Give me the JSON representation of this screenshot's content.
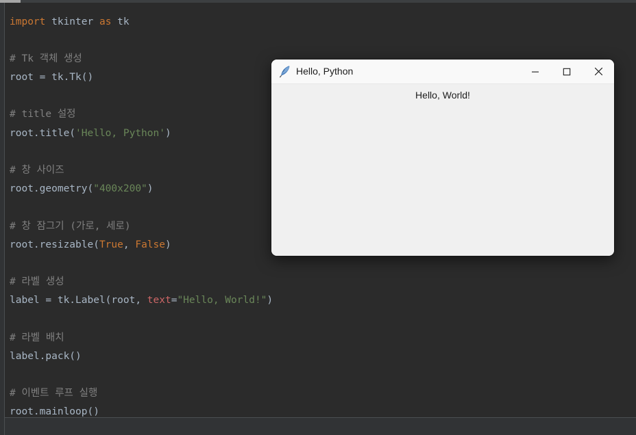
{
  "editor": {
    "scrollbar": {
      "name": "horizontal-scrollbar"
    },
    "lines": [
      {
        "i": 0,
        "tokens": [
          {
            "t": "kw",
            "v": "import"
          },
          {
            "t": "pln",
            "v": " tkinter "
          },
          {
            "t": "kw",
            "v": "as"
          },
          {
            "t": "pln",
            "v": " tk"
          }
        ]
      },
      {
        "i": 1,
        "tokens": []
      },
      {
        "i": 2,
        "tokens": [
          {
            "t": "cmt",
            "v": "# Tk 객체 생성"
          }
        ]
      },
      {
        "i": 3,
        "tokens": [
          {
            "t": "pln",
            "v": "root = tk.Tk()"
          }
        ]
      },
      {
        "i": 4,
        "tokens": []
      },
      {
        "i": 5,
        "tokens": [
          {
            "t": "cmt",
            "v": "# title 설정"
          }
        ]
      },
      {
        "i": 6,
        "tokens": [
          {
            "t": "pln",
            "v": "root.title("
          },
          {
            "t": "str",
            "v": "'Hello, Python'"
          },
          {
            "t": "pln",
            "v": ")"
          }
        ]
      },
      {
        "i": 7,
        "tokens": []
      },
      {
        "i": 8,
        "tokens": [
          {
            "t": "cmt",
            "v": "# 창 사이즈"
          }
        ]
      },
      {
        "i": 9,
        "tokens": [
          {
            "t": "pln",
            "v": "root.geometry("
          },
          {
            "t": "str",
            "v": "\"400x200\""
          },
          {
            "t": "pln",
            "v": ")"
          }
        ]
      },
      {
        "i": 10,
        "tokens": []
      },
      {
        "i": 11,
        "tokens": [
          {
            "t": "cmt",
            "v": "# 창 잠그기 (가로, 세로)"
          }
        ]
      },
      {
        "i": 12,
        "tokens": [
          {
            "t": "pln",
            "v": "root.resizable("
          },
          {
            "t": "kw",
            "v": "True"
          },
          {
            "t": "pln",
            "v": ", "
          },
          {
            "t": "kw",
            "v": "False"
          },
          {
            "t": "pln",
            "v": ")"
          }
        ]
      },
      {
        "i": 13,
        "tokens": []
      },
      {
        "i": 14,
        "tokens": [
          {
            "t": "cmt",
            "v": "# 라벨 생성"
          }
        ]
      },
      {
        "i": 15,
        "tokens": [
          {
            "t": "pln",
            "v": "label = tk.Label(root, "
          },
          {
            "t": "arg",
            "v": "text"
          },
          {
            "t": "pln",
            "v": "="
          },
          {
            "t": "str",
            "v": "\"Hello, World!\""
          },
          {
            "t": "pln",
            "v": ")"
          }
        ]
      },
      {
        "i": 16,
        "tokens": []
      },
      {
        "i": 17,
        "tokens": [
          {
            "t": "cmt",
            "v": "# 라벨 배치"
          }
        ]
      },
      {
        "i": 18,
        "tokens": [
          {
            "t": "pln",
            "v": "label.pack()"
          }
        ]
      },
      {
        "i": 19,
        "tokens": []
      },
      {
        "i": 20,
        "tokens": [
          {
            "t": "cmt",
            "v": "# 이벤트 루프 실행"
          }
        ]
      },
      {
        "i": 21,
        "tokens": [
          {
            "t": "pln",
            "v": "root.mainloop()"
          }
        ]
      }
    ],
    "colors": {
      "background": "#2b2b2b",
      "gutter": "#313335",
      "text": "#a9b7c6",
      "keyword": "#cc7832",
      "string": "#6a8759",
      "comment": "#808080",
      "named_argument": "#cc6666"
    }
  },
  "tk_window": {
    "title": "Hello, Python",
    "icon": "feather-quill-icon",
    "label_text": "Hello, World!",
    "controls": [
      {
        "name": "minimize",
        "glyph": "minimize-icon"
      },
      {
        "name": "maximize",
        "glyph": "maximize-icon"
      },
      {
        "name": "close",
        "glyph": "close-icon"
      }
    ],
    "colors": {
      "titlebar": "#f9f9f9",
      "body": "#f0f0f0",
      "title_text": "#1b1b1b"
    }
  }
}
